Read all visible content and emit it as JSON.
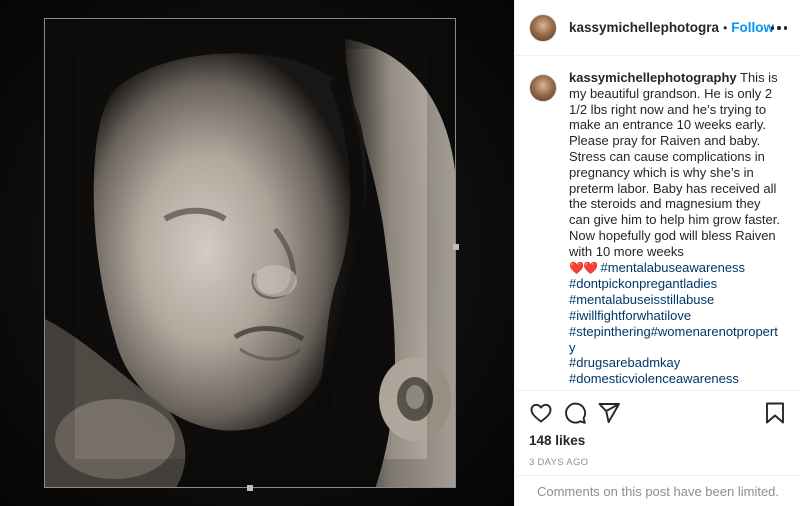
{
  "post": {
    "image_icon": "ultrasound-photo",
    "username": "kassymichellephotogra",
    "dot": "•",
    "follow_label": "Follow",
    "more_icon": "more-horizontal-icon"
  },
  "caption": {
    "username": "kassymichellephotography",
    "text": "This is my beautiful grandson. He is only 2 1/2 lbs right now and he’s trying to make an entrance 10 weeks early. Please pray for Raiven and baby. Stress can cause complications in pregnancy which is why she’s in preterm labor. Baby has received all the steroids and magnesium they can give him to help him grow faster. Now hopefully god will bless Raiven with 10 more weeks",
    "hearts": "❤️❤️",
    "hashtags": [
      "#mentalabuseawareness",
      "#dontpickonpregantladies",
      "#mentalabuseisstillabuse",
      "#iwillfightforwhatilove",
      "#stepinthering#womenarenotproperty",
      "#drugsarebadmkay",
      "#domesticviolenceawareness"
    ]
  },
  "actions": {
    "like_icon": "heart-icon",
    "comment_icon": "comment-icon",
    "share_icon": "share-icon",
    "save_icon": "bookmark-icon",
    "likes": "148 likes",
    "date": "3 DAYS AGO",
    "comments_limited": "Comments on this post have been limited."
  },
  "colors": {
    "link": "#0095f6",
    "hashtag": "#00376b",
    "muted": "#8e8e8e",
    "heart": "#ed2d2d"
  }
}
